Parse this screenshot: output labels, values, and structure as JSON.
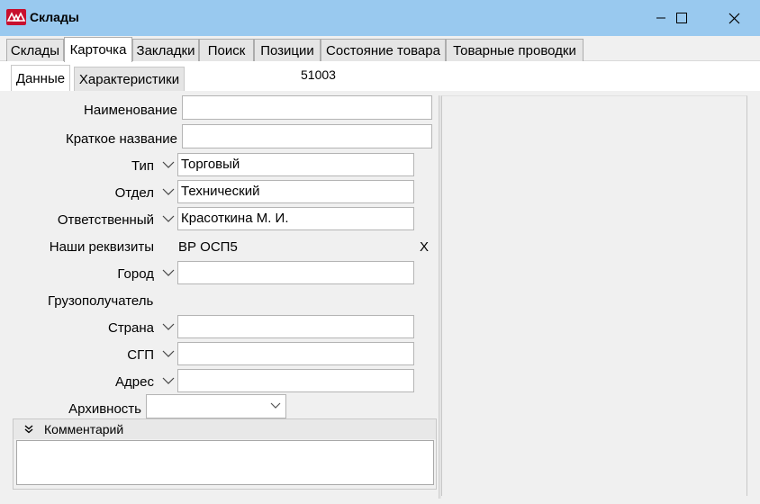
{
  "window": {
    "title": "Склады",
    "app_icon": "triangles-logo-icon",
    "controls": [
      "minimize-icon",
      "maximize-icon",
      "close-icon"
    ]
  },
  "tabs": [
    {
      "label": "Склады",
      "active": false
    },
    {
      "label": "Карточка",
      "active": true
    },
    {
      "label": "Закладки",
      "active": false
    },
    {
      "label": "Поиск",
      "active": false
    },
    {
      "label": "Позиции",
      "active": false
    },
    {
      "label": "Состояние товара",
      "active": false
    },
    {
      "label": "Товарные проводки",
      "active": false
    }
  ],
  "subtabs": [
    {
      "label": "Данные",
      "active": true
    },
    {
      "label": "Характеристики",
      "active": false
    }
  ],
  "record_code": "51003",
  "form": {
    "name": {
      "label": "Наименование",
      "value": ""
    },
    "short_name": {
      "label": "Краткое название",
      "value": ""
    },
    "type": {
      "label": "Тип",
      "value": "Торговый"
    },
    "department": {
      "label": "Отдел",
      "value": "Технический"
    },
    "responsible": {
      "label": "Ответственный",
      "value": "Красоткина М. И."
    },
    "requisites": {
      "label": "Наши реквизиты",
      "value": "ВР ОСП5",
      "clear": "X"
    },
    "city": {
      "label": "Город",
      "value": ""
    },
    "consignee": {
      "label": "Грузополучатель"
    },
    "country": {
      "label": "Страна",
      "value": ""
    },
    "sgp": {
      "label": "СГП",
      "value": ""
    },
    "address": {
      "label": "Адрес",
      "value": ""
    },
    "archive": {
      "label": "Архивность",
      "value": ""
    }
  },
  "comment": {
    "title": "Комментарий",
    "value": ""
  },
  "colors": {
    "titlebar": "#99c9ef",
    "app_icon": "#c8102e"
  }
}
